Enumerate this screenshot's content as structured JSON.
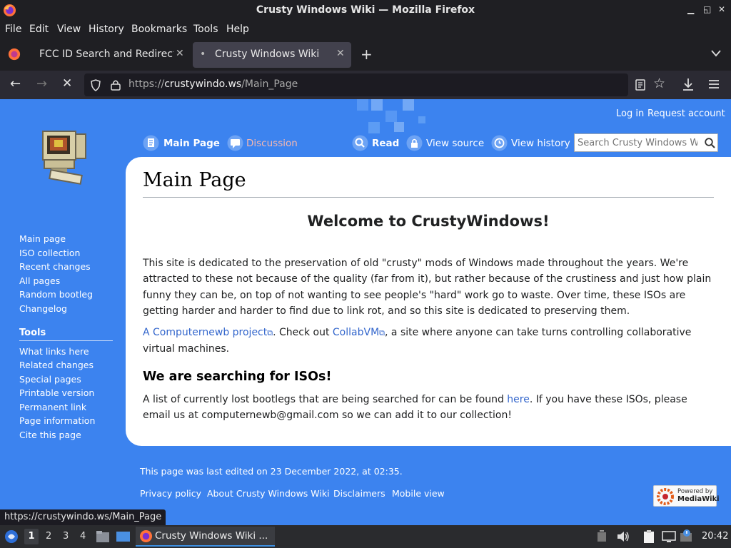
{
  "window": {
    "title": "Crusty Windows Wiki — Mozilla Firefox"
  },
  "menubar": {
    "items": [
      "File",
      "Edit",
      "View",
      "History",
      "Bookmarks",
      "Tools",
      "Help"
    ]
  },
  "tabs": [
    {
      "label": "FCC ID Search and Redirecti",
      "active": false
    },
    {
      "label": "Crusty Windows Wiki",
      "active": true
    }
  ],
  "navbar": {
    "url_prefix": "https://",
    "url_host": "crustywindo.ws",
    "url_path": "/Main_Page"
  },
  "wiki": {
    "personal": {
      "login": "Log in",
      "request": "Request account"
    },
    "tabs": {
      "main": "Main Page",
      "discussion": "Discussion",
      "read": "Read",
      "view_source": "View source",
      "view_history": "View history"
    },
    "search_placeholder": "Search Crusty Windows W",
    "nav": [
      "Main page",
      "ISO collection",
      "Recent changes",
      "All pages",
      "Random bootleg",
      "Changelog"
    ],
    "tools_heading": "Tools",
    "tools": [
      "What links here",
      "Related changes",
      "Special pages",
      "Printable version",
      "Permanent link",
      "Page information",
      "Cite this page"
    ],
    "page_title": "Main Page",
    "welcome": "Welcome to CrustyWindows!",
    "intro": "This site is dedicated to the preservation of old \"crusty\" mods of Windows made throughout the years. We're attracted to these not because of the quality (far from it), but rather because of the crustiness and just how plain funny they can be, on top of not wanting to see people's \"hard\" work go to waste. Over time, these ISOs are getting harder and harder to find due to link rot, and so this site is dedicated to preserving them.",
    "project_link": "A Computernewb project",
    "check_out": ". Check out ",
    "collab_link": "CollabVM",
    "collab_rest": ", a site where anyone can take turns controlling collaborative virtual machines.",
    "searching_heading": "We are searching for ISOs!",
    "searching_pre": "A list of currently lost bootlegs that are being searched for can be found ",
    "here_link": "here",
    "searching_post": ". If you have these ISOs, please email us at computernewb@gmail.com so we can add it to our collection!",
    "last_edited": "This page was last edited on 23 December 2022, at 02:35.",
    "footer_links": [
      "Privacy policy",
      "About Crusty Windows Wiki",
      "Disclaimers",
      "Mobile view"
    ],
    "powered_by_line1": "Powered by",
    "powered_by_line2": "MediaWiki"
  },
  "status_url": "https://crustywindo.ws/Main_Page",
  "taskbar": {
    "workspaces": [
      "1",
      "2",
      "3",
      "4"
    ],
    "window_label": "Crusty Windows Wiki ...",
    "clock": "20:42"
  },
  "colors": {
    "page_bg": "#3c83ef",
    "link": "#3366cc",
    "chrome": "#1f1f23"
  }
}
